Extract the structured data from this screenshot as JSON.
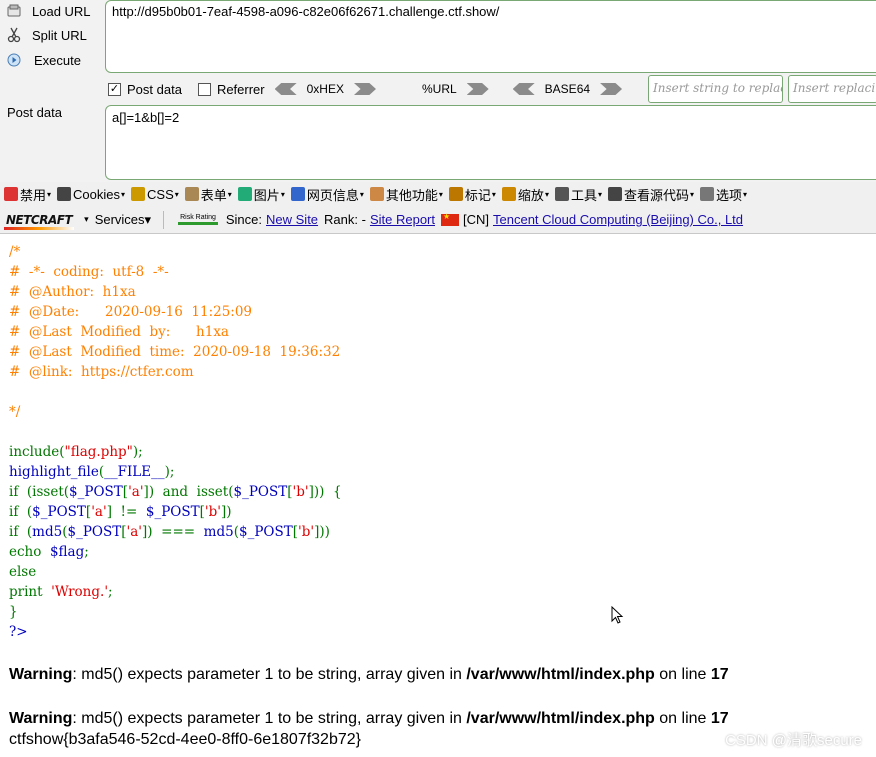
{
  "hackbar": {
    "load_url_label": "Load URL",
    "split_url_label": "Split URL",
    "execute_label": "Execute",
    "url_value": "http://d95b0b01-7eaf-4598-a096-c82e06f62671.challenge.ctf.show/",
    "post_data_checkbox_label": "Post data",
    "post_data_checked": true,
    "referrer_checkbox_label": "Referrer",
    "referrer_checked": false,
    "encodings": [
      "0xHEX",
      "%URL",
      "BASE64"
    ],
    "insert_placeholder": "Insert string to replace",
    "replacing_placeholder": "Insert replacing string",
    "post_label": "Post data",
    "post_value": "a[]=1&b[]=2"
  },
  "webdev_toolbar": {
    "items": [
      "禁用",
      "Cookies",
      "CSS",
      "表单",
      "图片",
      "网页信息",
      "其他功能",
      "标记",
      "缩放",
      "工具",
      "查看源代码",
      "选项"
    ],
    "colors": [
      "#d33",
      "#444",
      "#c90",
      "#a85",
      "#2a7",
      "#36c",
      "#c84",
      "#b70",
      "#c80",
      "#555",
      "#444",
      "#777"
    ]
  },
  "netcraft_toolbar": {
    "logo": "NETCRAFT",
    "services": "Services",
    "risk_rating": "Risk Rating",
    "since_label": "Since:",
    "since_value": "New Site",
    "rank_label": "Rank: -",
    "report_link": "Site Report",
    "country": "[CN]",
    "host_link": "Tencent Cloud Computing (Beijing) Co., Ltd"
  },
  "source_lines": [
    [
      {
        "t": "/*",
        "c": "comment"
      }
    ],
    [
      {
        "t": "#  -*-  coding:  utf-8  -*-",
        "c": "comment"
      }
    ],
    [
      {
        "t": "#  @Author:  h1xa",
        "c": "comment"
      }
    ],
    [
      {
        "t": "#  @Date:      2020-09-16  11:25:09",
        "c": "comment"
      }
    ],
    [
      {
        "t": "#  @Last  Modified  by:      h1xa",
        "c": "comment"
      }
    ],
    [
      {
        "t": "#  @Last  Modified  time:  2020-09-18  19:36:32",
        "c": "comment"
      }
    ],
    [
      {
        "t": "#  @link:  https://ctfer.com",
        "c": "comment"
      }
    ],
    [
      {
        "t": "",
        "c": "comment"
      }
    ],
    [
      {
        "t": "*/",
        "c": "comment"
      }
    ],
    [
      {
        "t": "",
        "c": "html"
      }
    ],
    [
      {
        "t": "include",
        "c": "kw"
      },
      {
        "t": "(",
        "c": "kw"
      },
      {
        "t": "\"flag.php\"",
        "c": "str"
      },
      {
        "t": ");",
        "c": "kw"
      }
    ],
    [
      {
        "t": "highlight_file",
        "c": "def"
      },
      {
        "t": "(",
        "c": "kw"
      },
      {
        "t": "__FILE__",
        "c": "def"
      },
      {
        "t": ");",
        "c": "kw"
      }
    ],
    [
      {
        "t": "if  (isset(",
        "c": "kw"
      },
      {
        "t": "$_POST",
        "c": "def"
      },
      {
        "t": "[",
        "c": "kw"
      },
      {
        "t": "'a'",
        "c": "str"
      },
      {
        "t": "])  and  isset(",
        "c": "kw"
      },
      {
        "t": "$_POST",
        "c": "def"
      },
      {
        "t": "[",
        "c": "kw"
      },
      {
        "t": "'b'",
        "c": "str"
      },
      {
        "t": "]))  {",
        "c": "kw"
      }
    ],
    [
      {
        "t": "if  (",
        "c": "kw"
      },
      {
        "t": "$_POST",
        "c": "def"
      },
      {
        "t": "[",
        "c": "kw"
      },
      {
        "t": "'a'",
        "c": "str"
      },
      {
        "t": "]  !=  ",
        "c": "kw"
      },
      {
        "t": "$_POST",
        "c": "def"
      },
      {
        "t": "[",
        "c": "kw"
      },
      {
        "t": "'b'",
        "c": "str"
      },
      {
        "t": "])",
        "c": "kw"
      }
    ],
    [
      {
        "t": "if  (",
        "c": "kw"
      },
      {
        "t": "md5",
        "c": "def"
      },
      {
        "t": "(",
        "c": "kw"
      },
      {
        "t": "$_POST",
        "c": "def"
      },
      {
        "t": "[",
        "c": "kw"
      },
      {
        "t": "'a'",
        "c": "str"
      },
      {
        "t": "])  ===  ",
        "c": "kw"
      },
      {
        "t": "md5",
        "c": "def"
      },
      {
        "t": "(",
        "c": "kw"
      },
      {
        "t": "$_POST",
        "c": "def"
      },
      {
        "t": "[",
        "c": "kw"
      },
      {
        "t": "'b'",
        "c": "str"
      },
      {
        "t": "]))",
        "c": "kw"
      }
    ],
    [
      {
        "t": "echo  ",
        "c": "kw"
      },
      {
        "t": "$flag",
        "c": "def"
      },
      {
        "t": ";",
        "c": "kw"
      }
    ],
    [
      {
        "t": "else",
        "c": "kw"
      }
    ],
    [
      {
        "t": "print  ",
        "c": "kw"
      },
      {
        "t": "'Wrong.'",
        "c": "str"
      },
      {
        "t": ";",
        "c": "kw"
      }
    ],
    [
      {
        "t": "}",
        "c": "kw"
      }
    ],
    [
      {
        "t": "?>",
        "c": "def"
      }
    ]
  ],
  "code_colors": {
    "comment": "#ff8000",
    "kw": "#007700",
    "def": "#0000bb",
    "str": "#dd0000",
    "html": "#000000"
  },
  "warnings": [
    {
      "label": "Warning",
      "message": ": md5() expects parameter 1 to be string, array given in ",
      "file": "/var/www/html/index.php",
      "on_line": " on line ",
      "line": "17"
    },
    {
      "label": "Warning",
      "message": ": md5() expects parameter 1 to be string, array given in ",
      "file": "/var/www/html/index.php",
      "on_line": " on line ",
      "line": "17"
    }
  ],
  "flag_output": "ctfshow{b3afa546-52cd-4ee0-8ff0-6e1807f32b72}",
  "watermark": "CSDN @清歌secure"
}
